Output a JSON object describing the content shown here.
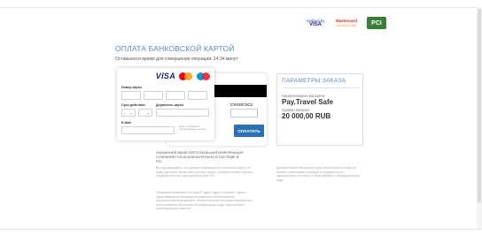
{
  "brand": {
    "verified_top": "Verified by",
    "verified_bottom": "VISA",
    "mastercard_title": "Mastercard",
    "mastercard_sub": "SecureCode",
    "pci": "PCI"
  },
  "header": {
    "title": "ОПЛАТА БАНКОВСКОЙ КАРТОЙ",
    "timer": "Оставшееся время для совершения операции: 14:34 минут"
  },
  "card_front": {
    "visa_logo": "VISA",
    "number_label": "Номер карты",
    "expiry_label": "Срок действия",
    "month_value": "-",
    "year_value": "-",
    "holder_label": "Держатель карты",
    "email_label": "E-Mail",
    "email_hint": "Будет отправлено подтверждение оплаты"
  },
  "card_back": {
    "cvv_label": "CVV2/CVC2"
  },
  "actions": {
    "pay_label": "ОПЛАТИТЬ"
  },
  "order": {
    "title": "ПАРАМЕТРЫ ЗАКАЗА",
    "store_label": "Наименование магазина:",
    "store_name": "Pay.Travel Safe",
    "amount_label": "Сумма платежа:",
    "amount": "20 000,00 RUB"
  },
  "security": {
    "heading": "УКАЗАННАЯ ВАМИ ПЕРСОНАЛЬНАЯ ИНФОРМАЦИЯ СОХРАНЯЕТСЯ ИСКЛЮЧИТЕЛЬНО В СИСТЕМЕ В PCI",
    "p1": "Вы подтверждаете, что данная информация в отношении карты, не будет доступна каким-либо третьим лицам, за исключением случаев, предусмотренных законодательством РФ.",
    "p2": "Обращаем внимание, что Ваш IP адрес будет сохранен с целью предотвращения несанкционированного использования персональной информации. Личные попытки несанкционированного использования персональной информации будут пресекаться и преследоваться законом.",
    "side": "Данные Вашей банковской карты используются только в момент совершения операции и передаются по защищенному протоколу в банк-эквайер в зашифрованном виде."
  }
}
